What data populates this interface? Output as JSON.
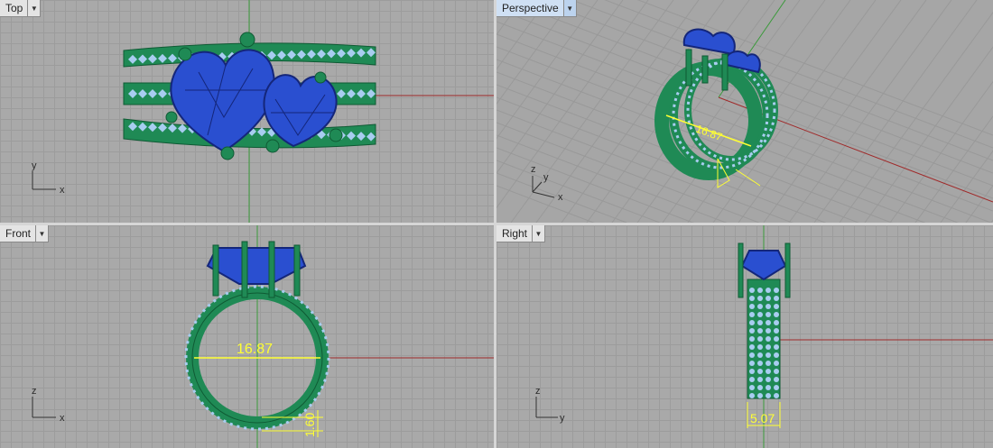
{
  "viewports": [
    {
      "name": "Top",
      "active": false,
      "axes": {
        "vertical": "y",
        "horizontal": "x"
      },
      "dimensions": []
    },
    {
      "name": "Perspective",
      "active": true,
      "axes": {
        "vertical": "z",
        "horizontal": "x",
        "depth": "y"
      },
      "dimensions": [
        {
          "label": "16.87"
        }
      ]
    },
    {
      "name": "Front",
      "active": false,
      "axes": {
        "vertical": "z",
        "horizontal": "x"
      },
      "dimensions": [
        {
          "label": "16.87"
        },
        {
          "label": "1.60"
        }
      ]
    },
    {
      "name": "Right",
      "active": false,
      "axes": {
        "vertical": "z",
        "horizontal": "y"
      },
      "dimensions": [
        {
          "label": "5.07"
        }
      ]
    }
  ],
  "dropdown_icon": "caret-down",
  "colors": {
    "metal": "#1f8a55",
    "metal_dark": "#0f5a34",
    "gem": "#2a4fd0",
    "gem_dark": "#14267a",
    "pave": "#a8cdf0",
    "dimension": "#ffff33",
    "x_axis": "#a02a2a",
    "y_axis": "#3a9a3a"
  }
}
